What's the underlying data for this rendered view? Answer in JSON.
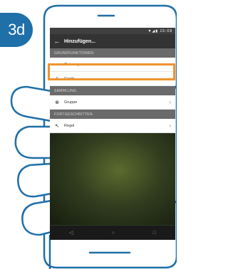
{
  "step": "3d",
  "status_bar": {
    "icons": "▼◢▮ 15:08"
  },
  "toolbar": {
    "back_icon": "arrow-left-icon",
    "title": "Hinzufügen..."
  },
  "sections": [
    {
      "header": "GRUNDFUNKTIONEN",
      "items": [
        {
          "label": "Gateway",
          "icon": "gateway-icon",
          "highlighted": true
        },
        {
          "label": "Gerät",
          "icon": "bulb-icon",
          "highlighted": false
        }
      ]
    },
    {
      "header": "SAMMLUNG",
      "items": [
        {
          "label": "Gruppe",
          "icon": "group-icon",
          "highlighted": false
        }
      ]
    },
    {
      "header": "FORTGESCHRITTEN",
      "items": [
        {
          "label": "Regel",
          "icon": "rule-icon",
          "highlighted": false
        }
      ]
    }
  ],
  "nav_bar": [
    "back-triangle-icon",
    "home-circle-icon",
    "recents-square-icon"
  ],
  "colors": {
    "badge": "#1f6fa8",
    "highlight": "#f0932e",
    "toolbar": "#333333"
  }
}
